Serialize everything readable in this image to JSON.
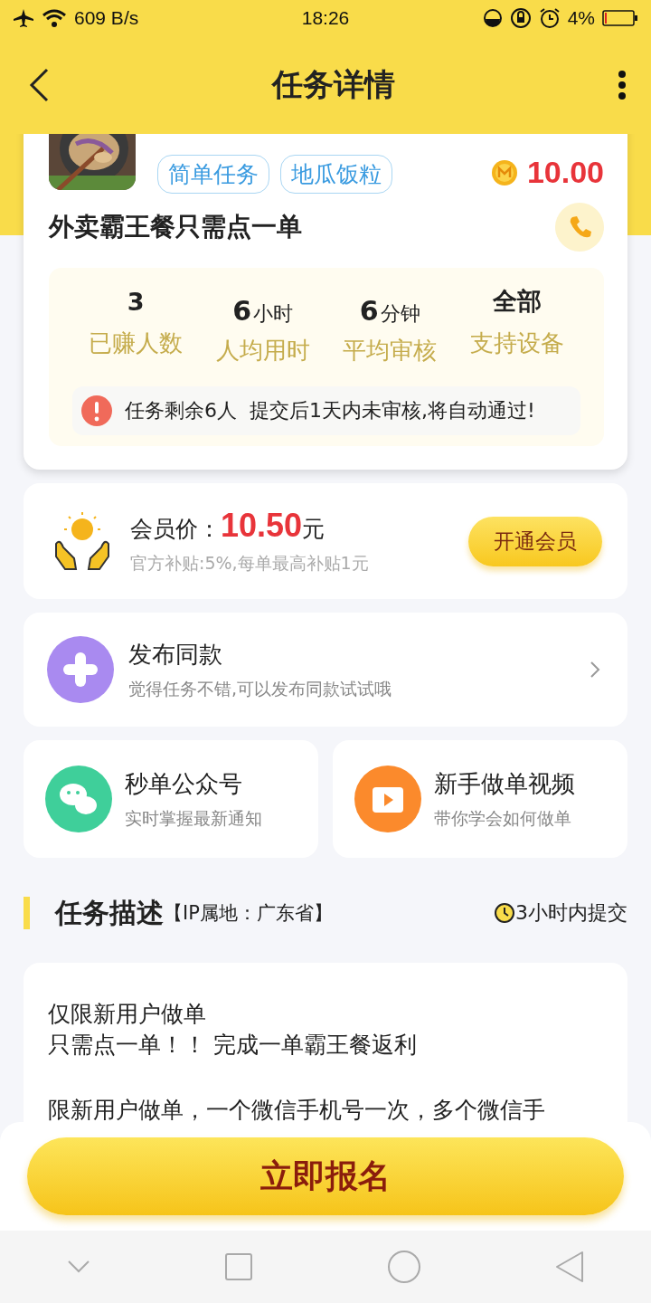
{
  "status_bar": {
    "speed": "609 B/s",
    "time": "18:26",
    "battery": "4%"
  },
  "header": {
    "title": "任务详情"
  },
  "task": {
    "tags": [
      "简单任务",
      "地瓜饭粒"
    ],
    "reward": "10.00",
    "title": "外卖霸王餐只需点一单",
    "stats": [
      {
        "value": "3",
        "label": "已赚人数"
      },
      {
        "value": "6",
        "unit": "小时",
        "label": "人均用时"
      },
      {
        "value": "6",
        "unit": "分钟",
        "label": "平均审核"
      },
      {
        "value": "全部",
        "label": "支持设备"
      }
    ],
    "notice": [
      "任务剩余6人",
      "提交后1天内未审核,将自动通过!"
    ]
  },
  "member": {
    "label": "会员价：",
    "price": "10.50",
    "unit": "元",
    "note": "官方补贴:5%,每单最高补贴1元",
    "button": "开通会员"
  },
  "publish": {
    "title": "发布同款",
    "subtitle": "觉得任务不错,可以发布同款试试哦"
  },
  "shortcuts": [
    {
      "kind": "wechat",
      "title": "秒单公众号",
      "subtitle": "实时掌握最新通知"
    },
    {
      "kind": "video",
      "title": "新手做单视频",
      "subtitle": "带你学会如何做单"
    }
  ],
  "section": {
    "title": "任务描述",
    "ip": "【IP属地：广东省】",
    "deadline": "3小时内提交"
  },
  "description": [
    [
      "仅限新用户做单",
      "只需点一单！！ 完成一单霸王餐返利"
    ],
    [
      "限新用户做单，一个微信手机号一次，多个微信手"
    ]
  ],
  "cta": "立即报名"
}
